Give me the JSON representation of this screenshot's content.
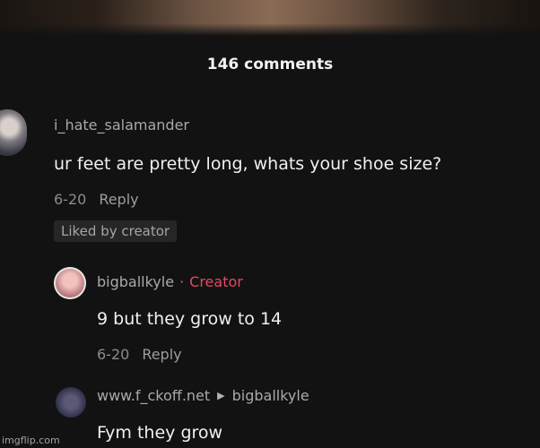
{
  "header": {
    "comments_count": "146 comments"
  },
  "comments": [
    {
      "username": "i_hate_salamander",
      "text": "ur feet are pretty long, whats your shoe size?",
      "date": "6-20",
      "reply_label": "Reply",
      "liked_badge": "Liked by creator",
      "avatar_icon": "user-avatar-icon"
    },
    {
      "username": "bigballkyle",
      "separator": "·",
      "creator_label": "Creator",
      "text": "9 but they grow to 14",
      "date": "6-20",
      "reply_label": "Reply",
      "avatar_icon": "user-avatar-icon"
    },
    {
      "username": "www.f_ckoff.net",
      "reply_arrow": "▶",
      "reply_to": "bigballkyle",
      "text": "Fym they grow",
      "avatar_icon": "user-avatar-icon"
    }
  ],
  "watermark": "imgflip.com",
  "colors": {
    "background": "#121212",
    "creator": "#e24a62"
  }
}
